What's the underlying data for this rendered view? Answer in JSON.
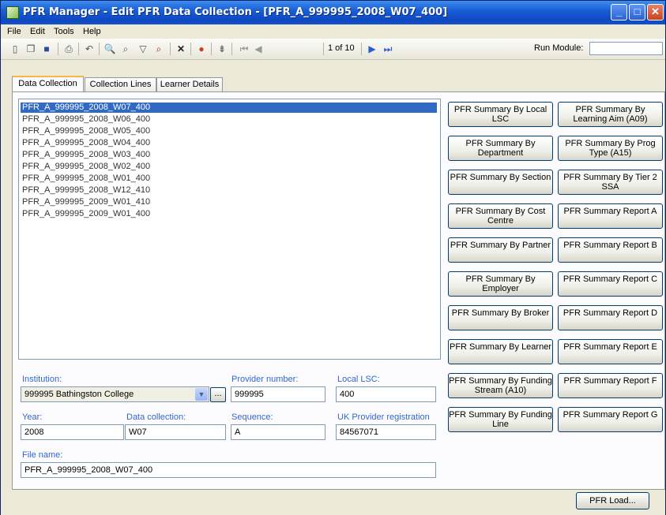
{
  "window": {
    "title": "PFR Manager - Edit PFR Data Collection - [PFR_A_999995_2008_W07_400]"
  },
  "menu": [
    "File",
    "Edit",
    "Tools",
    "Help"
  ],
  "toolbar": {
    "page_info": "1 of 10",
    "run_module_label": "Run Module:",
    "run_module_value": ""
  },
  "tabs": [
    "Data Collection",
    "Collection Lines",
    "Learner Details"
  ],
  "collections": [
    "PFR_A_999995_2008_W07_400",
    "PFR_A_999995_2008_W06_400",
    "PFR_A_999995_2008_W05_400",
    "PFR_A_999995_2008_W04_400",
    "PFR_A_999995_2008_W03_400",
    "PFR_A_999995_2008_W02_400",
    "PFR_A_999995_2008_W01_400",
    "PFR_A_999995_2008_W12_410",
    "PFR_A_999995_2009_W01_410",
    "PFR_A_999995_2009_W01_400"
  ],
  "report_buttons": {
    "left": [
      "PFR Summary By Local LSC",
      "PFR Summary By Department",
      "PFR Summary By Section",
      "PFR Summary By Cost Centre",
      "PFR Summary By Partner",
      "PFR Summary By Employer",
      "PFR Summary By Broker",
      "PFR Summary By Learner",
      "PFR Summary By Funding Stream (A10)",
      "PFR Summary By Funding Line"
    ],
    "right": [
      "PFR Summary By Learning Aim (A09)",
      "PFR Summary By Prog Type (A15)",
      "PFR Summary By Tier 2 SSA",
      "PFR Summary Report A",
      "PFR Summary Report B",
      "PFR Summary Report C",
      "PFR Summary Report D",
      "PFR Summary Report E",
      "PFR Summary Report F",
      "PFR Summary Report G"
    ]
  },
  "form": {
    "institution_label": "Institution:",
    "institution_value": "999995 Bathingston College",
    "browse_label": "...",
    "provider_number_label": "Provider number:",
    "provider_number_value": "999995",
    "local_lsc_label": "Local LSC:",
    "local_lsc_value": "400",
    "year_label": "Year:",
    "year_value": "2008",
    "data_collection_label": "Data collection:",
    "data_collection_value": "W07",
    "sequence_label": "Sequence:",
    "sequence_value": "A",
    "ukprn_label": "UK Provider registration",
    "ukprn_value": "84567071",
    "file_name_label": "File name:",
    "file_name_value": "PFR_A_999995_2008_W07_400"
  },
  "footer": {
    "load_button": "PFR Load..."
  }
}
